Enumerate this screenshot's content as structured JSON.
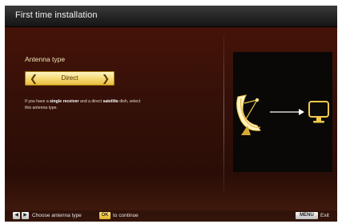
{
  "header": {
    "title": "First time installation"
  },
  "antenna": {
    "label": "Antenna type",
    "selected_value": "Direct",
    "left_icon": "chevron-left-icon",
    "right_icon": "chevron-right-icon"
  },
  "description": {
    "part1": "If you have a ",
    "bold1": "single receiver",
    "part2": " and a direct ",
    "bold2": "satellite",
    "part3": " dish, select",
    "line2": "this antenna type."
  },
  "illustration": {
    "dish_icon": "satellite-dish-icon",
    "arrow_icon": "arrow-right-icon",
    "tv_icon": "tv-icon",
    "accent": "#f2c94c"
  },
  "footer": {
    "nav_hint": "Choose antenna type",
    "ok_label": "OK",
    "ok_hint": "to continue",
    "menu_label": "MENU",
    "exit_label": "Exit"
  },
  "colors": {
    "background": "#3a1008",
    "header": "#232323",
    "selector_gold": "#f6d871"
  }
}
